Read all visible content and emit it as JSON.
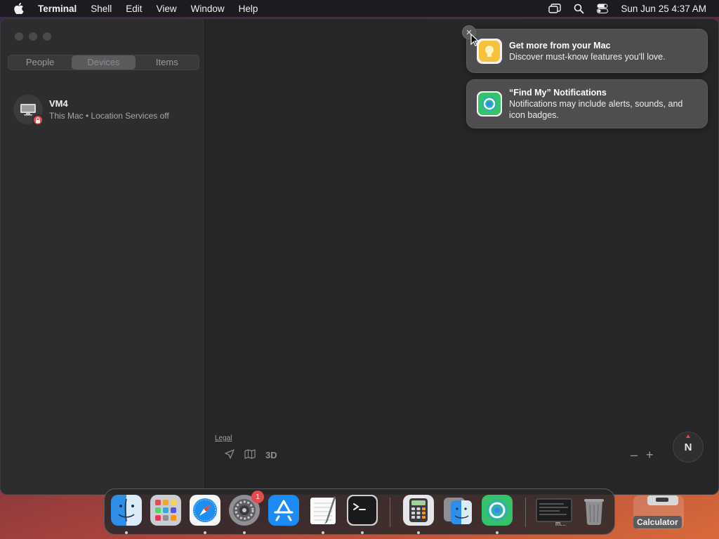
{
  "menubar": {
    "app_name": "Terminal",
    "items": [
      "Shell",
      "Edit",
      "View",
      "Window",
      "Help"
    ],
    "clock": "Sun Jun 25  4:37 AM"
  },
  "sidebar": {
    "tabs": [
      "People",
      "Devices",
      "Items"
    ],
    "active_tab": "Devices",
    "devices": [
      {
        "name": "VM4",
        "detail": "This Mac • Location Services off"
      }
    ]
  },
  "map": {
    "legal": "Legal",
    "mode_3d": "3D",
    "zoom_out": "–",
    "zoom_in": "+",
    "compass": "N"
  },
  "notifications": [
    {
      "title": "Get more from your Mac",
      "body": "Discover must-know features you'll love."
    },
    {
      "title": "“Find My” Notifications",
      "body": "Notifications may include alerts, sounds, and icon badges."
    }
  ],
  "dock": {
    "settings_badge": "1",
    "terminal_thumb_label": "m...",
    "calculator_label": "Calculator"
  }
}
